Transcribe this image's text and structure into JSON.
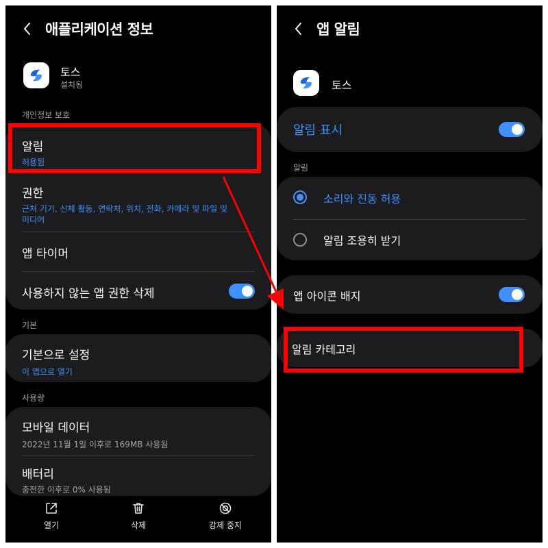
{
  "left": {
    "title": "애플리케이션 정보",
    "app_name": "토스",
    "app_status": "설치됨",
    "sections": {
      "privacy": "개인정보 보호",
      "default": "기본",
      "usage": "사용량"
    },
    "notifications": {
      "title": "알림",
      "value": "허용됨"
    },
    "permissions": {
      "title": "권한",
      "value_line1": "근처 기기, 신체 활동, 연락처, 위치, 전화, 카메라 및 파일 및",
      "value_line2": "미디어"
    },
    "app_timer": {
      "title": "앱 타이머"
    },
    "remove_permissions": {
      "title": "사용하지 않는 앱 권한 삭제",
      "enabled": true
    },
    "set_default": {
      "title": "기본으로 설정",
      "value": "이 앱으로 열기"
    },
    "mobile_data": {
      "title": "모바일 데이터",
      "value": "2022년 11월 1일 이후로 169MB 사용됨"
    },
    "battery": {
      "title": "배터리",
      "value": "충전한 이후로 0% 사용됨"
    },
    "bottom_bar": [
      {
        "label": "열기",
        "icon": "open-external-icon"
      },
      {
        "label": "삭제",
        "icon": "trash-icon"
      },
      {
        "label": "강제 중지",
        "icon": "force-stop-icon"
      }
    ]
  },
  "right": {
    "title": "앱 알림",
    "app_name": "토스",
    "show_notifications": {
      "title": "알림 표시",
      "enabled": true
    },
    "section_label": "알림",
    "options": [
      {
        "label": "소리와 진동 허용",
        "selected": true
      },
      {
        "label": "알림 조용히 받기",
        "selected": false
      }
    ],
    "icon_badge": {
      "title": "앱 아이콘 배지",
      "enabled": true
    },
    "categories": {
      "title": "알림 카테고리"
    }
  },
  "colors": {
    "accent": "#3e91ff",
    "highlight": "#ff0000",
    "card_bg": "#1c1c1e",
    "screen_bg": "#000000",
    "toss_blue": "#1b64da"
  }
}
